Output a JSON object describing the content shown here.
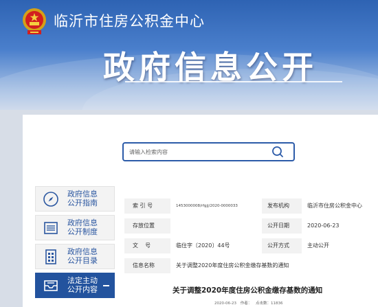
{
  "header": {
    "site_name": "临沂市住房公积金中心",
    "banner_title": "政府信息公开",
    "emblem_icon": "national-emblem-icon"
  },
  "search": {
    "placeholder": "请输入检索内容",
    "icon": "search-icon"
  },
  "sidebar": {
    "items": [
      {
        "line1": "政府信息",
        "line2": "公开指南",
        "icon": "compass-icon",
        "active": false
      },
      {
        "line1": "政府信息",
        "line2": "公开制度",
        "icon": "document-list-icon",
        "active": false
      },
      {
        "line1": "政府信息",
        "line2": "公开目录",
        "icon": "catalog-icon",
        "active": false
      },
      {
        "line1": "法定主动",
        "line2": "公开内容",
        "icon": "inbox-icon",
        "active": true
      }
    ]
  },
  "info": {
    "index_label": "索 引 号",
    "index_value": "1453000008/rfgjj/2020-0000033",
    "publisher_label": "发布机构",
    "publisher_value": "临沂市住房公积金中心",
    "storage_label": "存放位置",
    "storage_value": "",
    "publish_date_label": "公开日期",
    "publish_date_value": "2020-06-23",
    "doc_no_label": "文    号",
    "doc_no_value": "临住字〔2020〕44号",
    "method_label": "公开方式",
    "method_value": "主动公开",
    "name_label": "信息名称",
    "name_value": "关于调整2020年度住房公积金缴存基数的通知"
  },
  "document": {
    "title": "关于调整2020年度住房公积金缴存基数的通知",
    "date": "2020-06-23",
    "author_label": "作者：",
    "views_label": "点击数：11836"
  },
  "colors": {
    "accent": "#23539e",
    "banner_top": "#2e63b3"
  }
}
